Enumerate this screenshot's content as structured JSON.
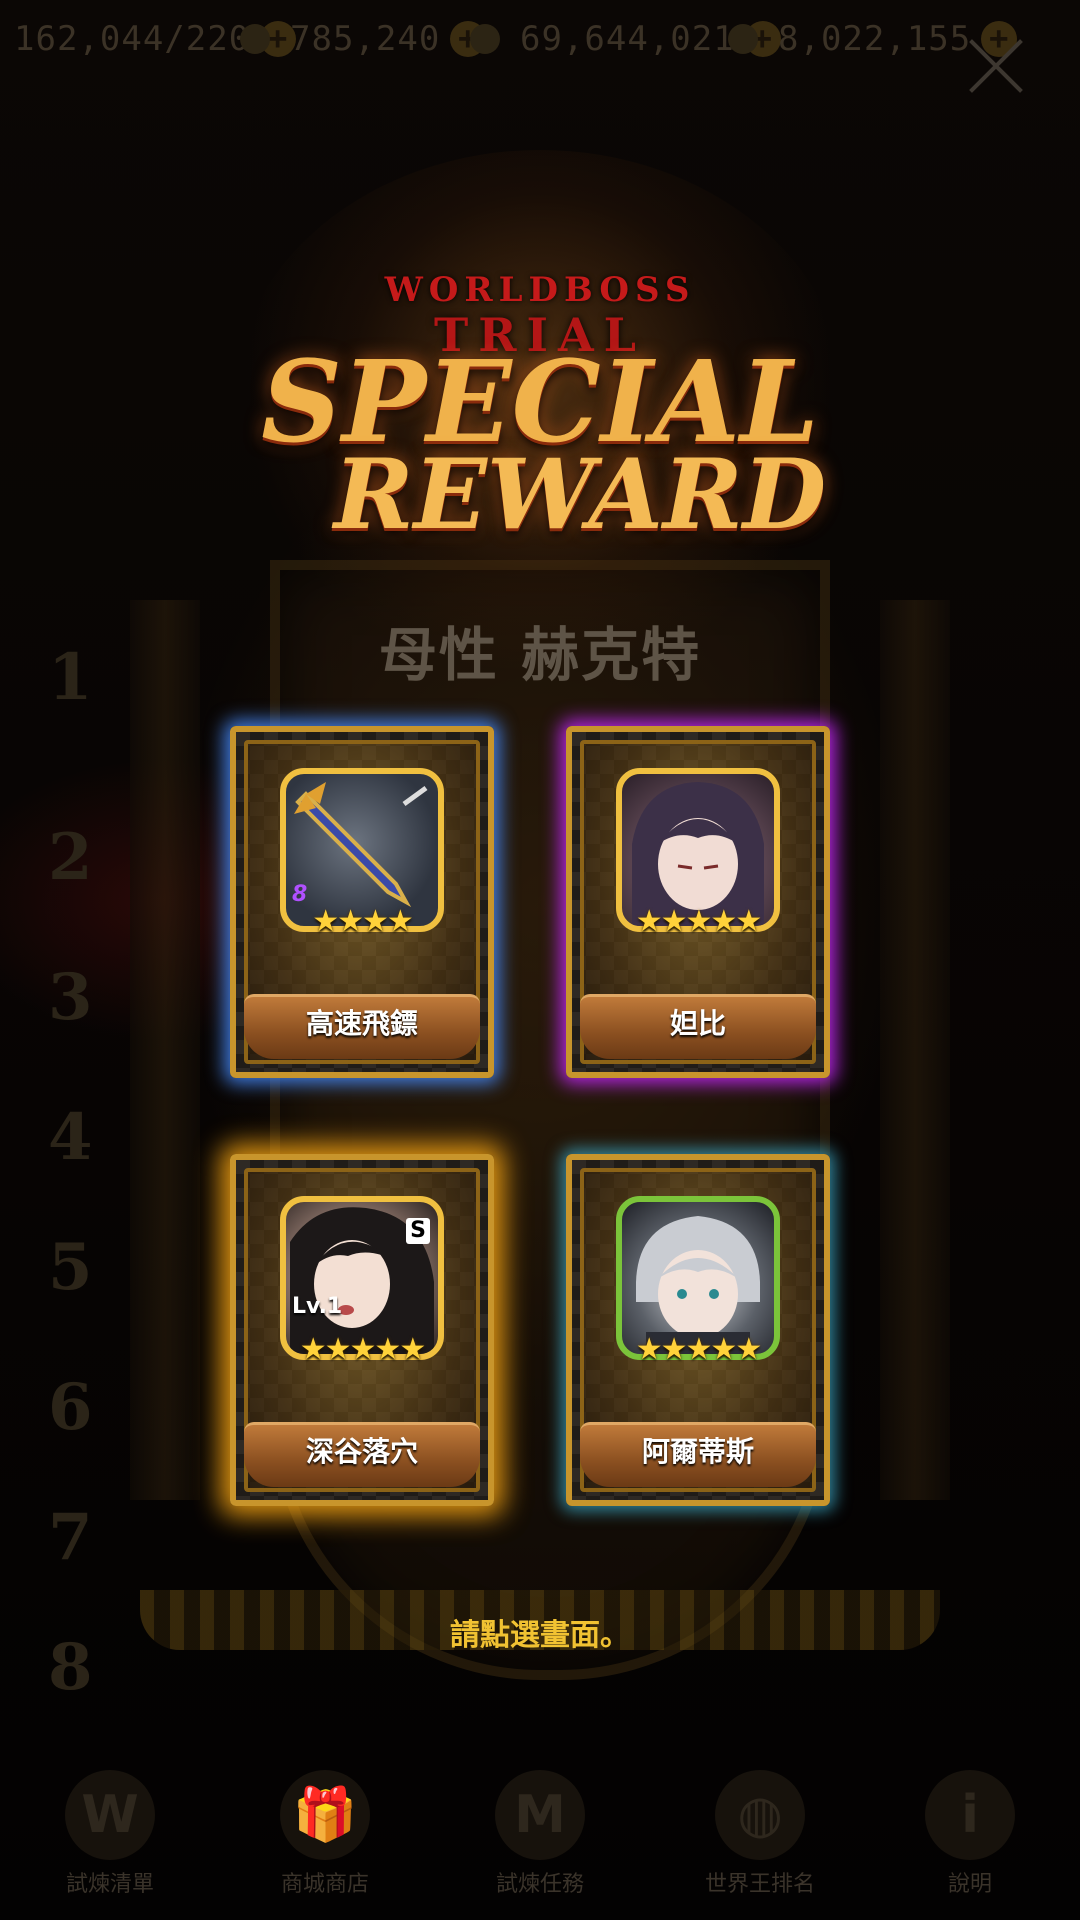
{
  "resources": [
    {
      "icon": "stamina-icon",
      "value": "162,044/220"
    },
    {
      "icon": "gem-icon",
      "value": "785,240"
    },
    {
      "icon": "gold-coin-icon",
      "value": "69,644,021"
    },
    {
      "icon": "crystal-icon",
      "value": "8,022,155"
    }
  ],
  "header": {
    "logo_line1": "WORLDBOSS",
    "logo_line2": "TRIAL",
    "title_line1": "SPECIAL",
    "title_line2": "REWARD"
  },
  "boss_name": "母性 赫克特",
  "rewards": [
    {
      "name": "高速飛鏢",
      "stars": "★★★★",
      "rarity": 4,
      "badge": "8",
      "glow": "#468cff"
    },
    {
      "name": "妲比",
      "stars": "★★★★★",
      "rarity": 5,
      "badge": "",
      "glow": "#c828ff"
    },
    {
      "name": "深谷落穴",
      "stars": "★★★★★",
      "rarity": 5,
      "badge": "Lv.1",
      "tag": "S",
      "glow": "#ffaa14"
    },
    {
      "name": "阿爾蒂斯",
      "stars": "★★★★★",
      "rarity": 5,
      "badge": "",
      "glow": "#3caac8"
    }
  ],
  "prompt": "請點選畫面。",
  "nav": [
    {
      "label": "試煉清單",
      "icon": "world-boss-icon"
    },
    {
      "label": "商城商店",
      "icon": "gift-icon"
    },
    {
      "label": "試煉任務",
      "icon": "mission-icon"
    },
    {
      "label": "世界王排名",
      "icon": "rank-globe-icon"
    },
    {
      "label": "說明",
      "icon": "info-icon"
    }
  ]
}
